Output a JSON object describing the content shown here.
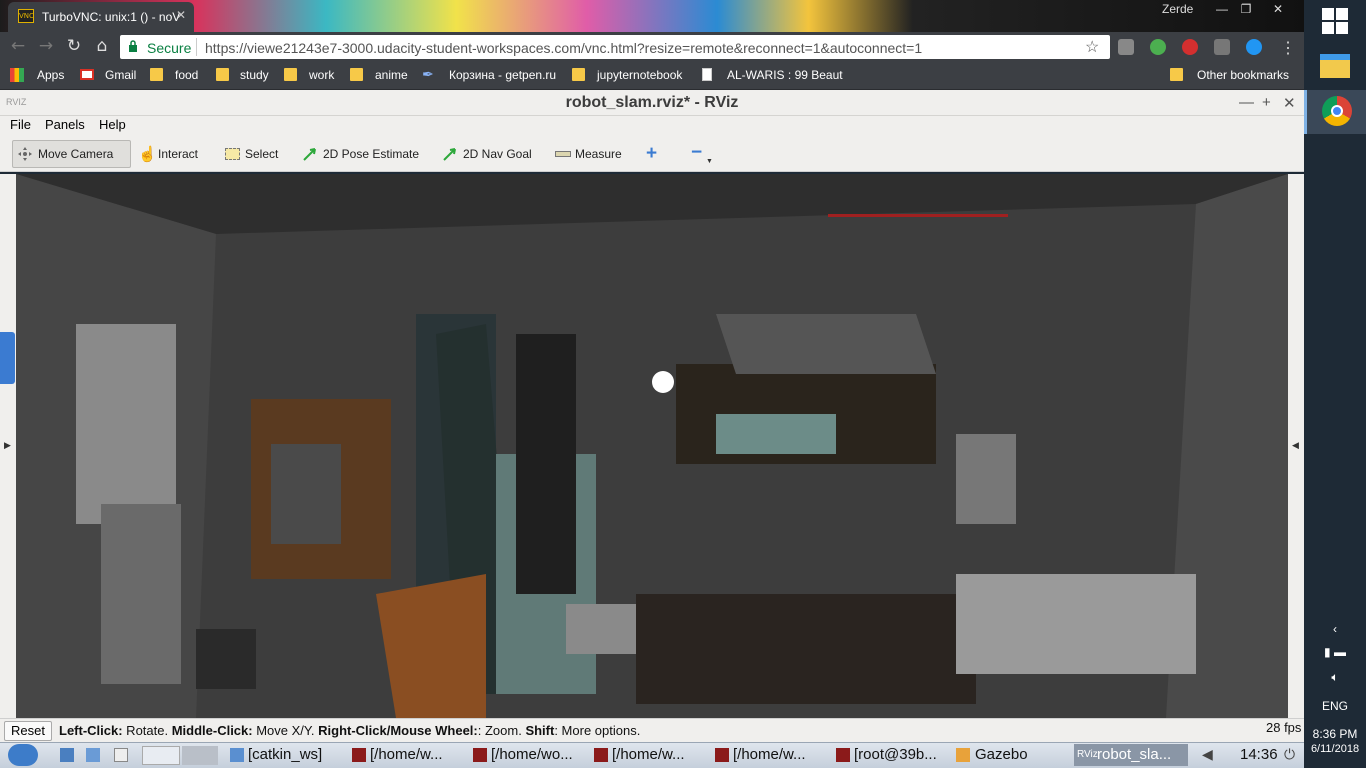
{
  "browser": {
    "tab_title": "TurboVNC: unix:1 () - noV",
    "tab_icon_text": "VNC",
    "profile_name": "Zerde",
    "secure_label": "Secure",
    "url": "https://viewe21243e7-3000.udacity-student-workspaces.com/vnc.html?resize=remote&reconnect=1&autoconnect=1",
    "bookmarks": [
      {
        "label": "Apps",
        "icon": "apps-grid-icon"
      },
      {
        "label": "Gmail",
        "icon": "gmail-icon"
      },
      {
        "label": "food",
        "icon": "folder-icon"
      },
      {
        "label": "study",
        "icon": "folder-icon"
      },
      {
        "label": "work",
        "icon": "folder-icon"
      },
      {
        "label": "anime",
        "icon": "folder-icon"
      },
      {
        "label": "Корзина - getpen.ru",
        "icon": "pen-icon"
      },
      {
        "label": "jupyternotebook",
        "icon": "folder-icon"
      },
      {
        "label": "AL-WARIS : 99 Beaut",
        "icon": "page-icon"
      },
      {
        "label": "Other bookmarks",
        "icon": "folder-icon"
      }
    ]
  },
  "rviz": {
    "logo_text": "RVIZ",
    "title": "robot_slam.rviz* - RViz",
    "menu": [
      "File",
      "Panels",
      "Help"
    ],
    "tools": {
      "move_camera": "Move Camera",
      "interact": "Interact",
      "select": "Select",
      "pose_estimate": "2D Pose Estimate",
      "nav_goal": "2D Nav Goal",
      "measure": "Measure"
    },
    "reset_label": "Reset",
    "status": {
      "left_click_key": "Left-Click:",
      "left_click_val": " Rotate. ",
      "middle_click_key": "Middle-Click:",
      "middle_click_val": " Move X/Y. ",
      "right_click_key": "Right-Click/Mouse Wheel:",
      "right_click_val": ": Zoom. ",
      "shift_key": "Shift",
      "shift_val": ": More options."
    },
    "fps": "28 fps"
  },
  "vnc_taskbar": {
    "tasks": [
      {
        "label": "[catkin_ws]",
        "icon": "folder-icon"
      },
      {
        "label": "[/home/w...",
        "icon": "terminal-icon"
      },
      {
        "label": "[/home/wo...",
        "icon": "terminal-icon"
      },
      {
        "label": "[/home/w...",
        "icon": "terminal-icon"
      },
      {
        "label": "[/home/w...",
        "icon": "terminal-icon"
      },
      {
        "label": "[root@39b...",
        "icon": "terminal-icon"
      },
      {
        "label": "Gazebo",
        "icon": "gazebo-icon"
      },
      {
        "label": "robot_sla...",
        "icon": "rviz-icon",
        "prefix": "RViz"
      }
    ],
    "clock": "14:36"
  },
  "windows": {
    "language": "ENG",
    "time": "8:36 PM",
    "date": "6/11/2018"
  },
  "colors": {
    "viewport_bg": "#3a3a3a",
    "chrome_dark": "#3c3f44",
    "secure_green": "#0b8043",
    "win_taskbar": "#1e2a36",
    "rviz_panel": "#f0efed"
  }
}
